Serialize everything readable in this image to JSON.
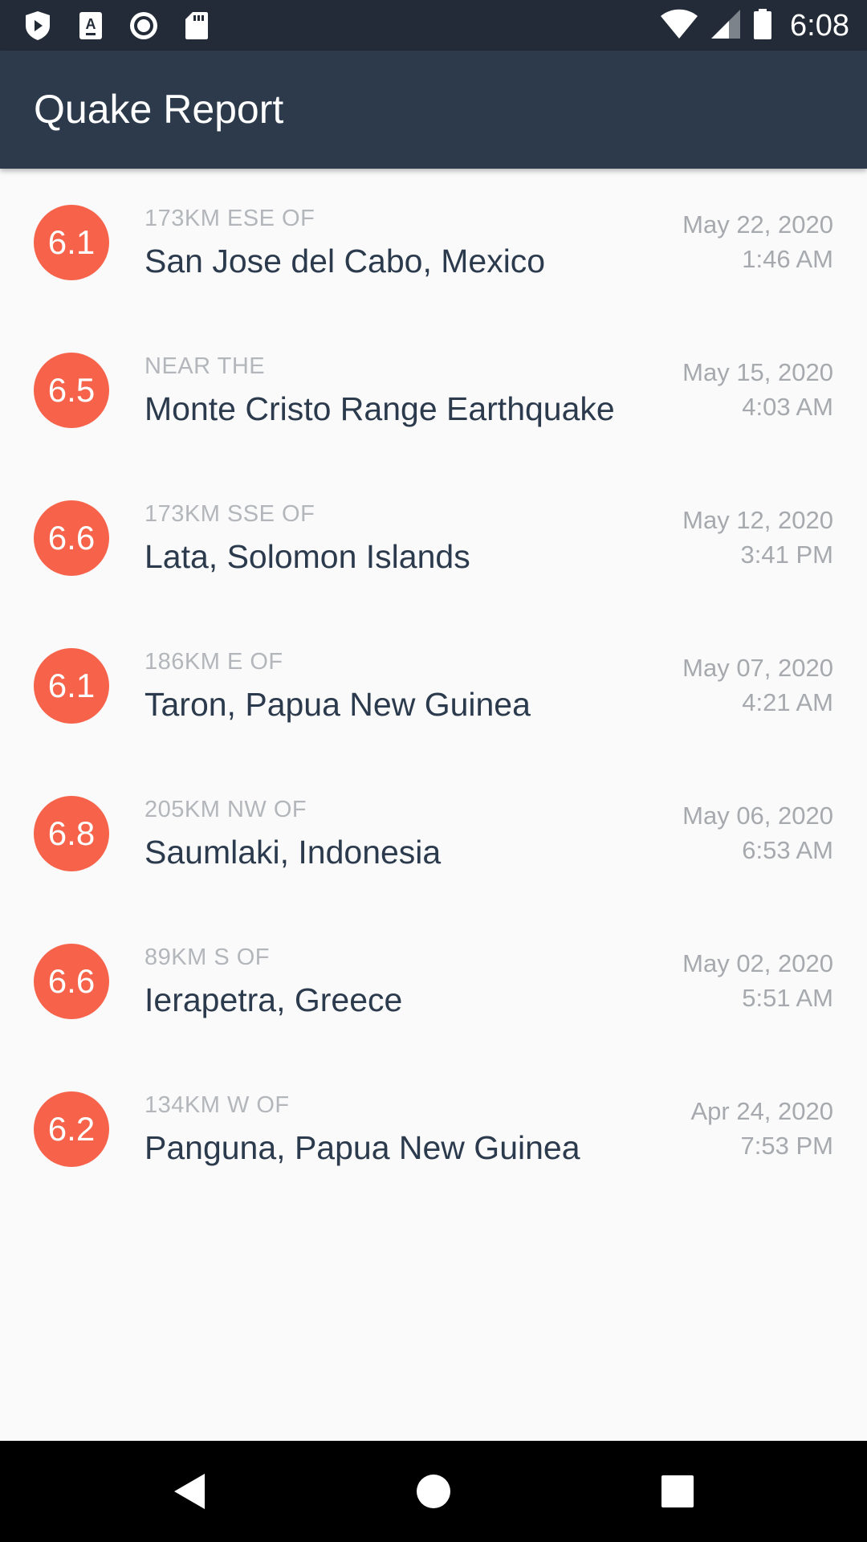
{
  "status_bar": {
    "time": "6:08",
    "left_icons": [
      "play-protect-icon",
      "a-keyboard-icon",
      "record-icon",
      "sd-card-icon"
    ],
    "right_icons": [
      "wifi-icon",
      "signal-icon",
      "battery-icon"
    ]
  },
  "app_bar": {
    "title": "Quake Report",
    "background": "#2c3a4b"
  },
  "accent": "#f7634a",
  "earthquakes": [
    {
      "magnitude": "6.1",
      "offset": "173KM ESE OF",
      "place": "San Jose del Cabo, Mexico",
      "date": "May 22, 2020",
      "time": "1:46 AM"
    },
    {
      "magnitude": "6.5",
      "offset": "NEAR THE",
      "place": "Monte Cristo Range Earthquake",
      "date": "May 15, 2020",
      "time": "4:03 AM"
    },
    {
      "magnitude": "6.6",
      "offset": "173KM SSE OF",
      "place": "Lata, Solomon Islands",
      "date": "May 12, 2020",
      "time": "3:41 PM"
    },
    {
      "magnitude": "6.1",
      "offset": "186KM E OF",
      "place": "Taron, Papua New Guinea",
      "date": "May 07, 2020",
      "time": "4:21 AM"
    },
    {
      "magnitude": "6.8",
      "offset": "205KM NW OF",
      "place": "Saumlaki, Indonesia",
      "date": "May 06, 2020",
      "time": "6:53 AM"
    },
    {
      "magnitude": "6.6",
      "offset": "89KM S OF",
      "place": "Ierapetra, Greece",
      "date": "May 02, 2020",
      "time": "5:51 AM"
    },
    {
      "magnitude": "6.2",
      "offset": "134KM W OF",
      "place": "Panguna, Papua New Guinea",
      "date": "Apr 24, 2020",
      "time": "7:53 PM"
    }
  ],
  "nav_bar": {
    "buttons": [
      "back-icon",
      "home-icon",
      "recents-icon"
    ]
  }
}
